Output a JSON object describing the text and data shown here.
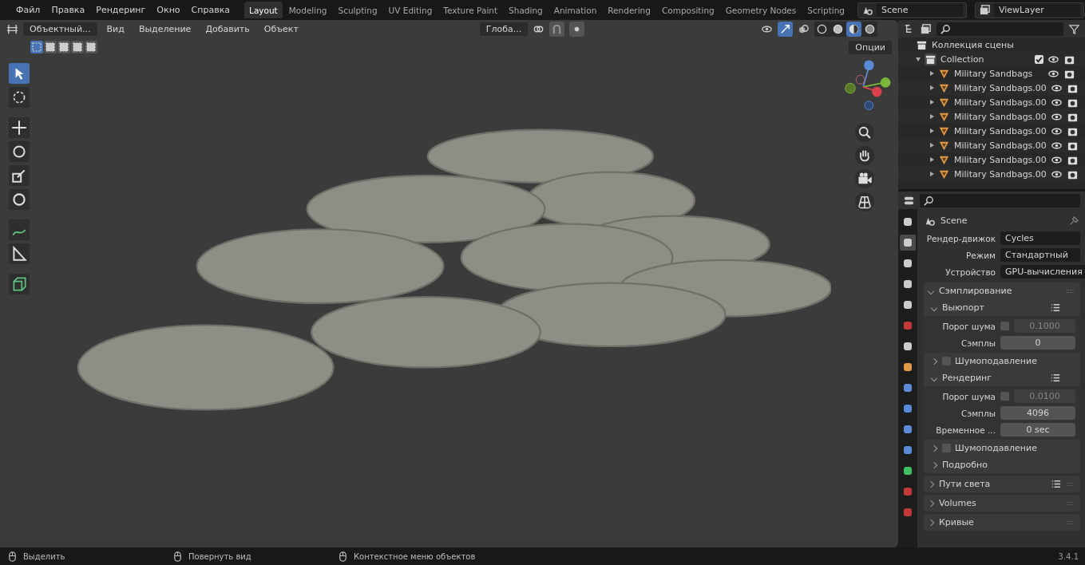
{
  "menu": [
    "Файл",
    "Правка",
    "Рендеринг",
    "Окно",
    "Справка"
  ],
  "workspaces": [
    {
      "label": "Layout",
      "selected": true
    },
    {
      "label": "Modeling",
      "selected": false
    },
    {
      "label": "Sculpting",
      "selected": false
    },
    {
      "label": "UV Editing",
      "selected": false
    },
    {
      "label": "Texture Paint",
      "selected": false
    },
    {
      "label": "Shading",
      "selected": false
    },
    {
      "label": "Animation",
      "selected": false
    },
    {
      "label": "Rendering",
      "selected": false
    },
    {
      "label": "Compositing",
      "selected": false
    },
    {
      "label": "Geometry Nodes",
      "selected": false
    },
    {
      "label": "Scripting",
      "selected": false
    }
  ],
  "scene": "Scene",
  "view_layer": "ViewLayer",
  "viewport": {
    "mode": "Объектный...",
    "menus": [
      "Вид",
      "Выделение",
      "Добавить",
      "Объект"
    ],
    "orientation": "Глоба...",
    "options": "Опции",
    "select_modes": [
      {
        "selected": true
      },
      {
        "selected": false
      },
      {
        "selected": false
      },
      {
        "selected": false
      },
      {
        "selected": false
      }
    ],
    "overlays_on": true,
    "shading": [
      {
        "kind": "wire",
        "selected": false
      },
      {
        "kind": "solid",
        "selected": false
      },
      {
        "kind": "material",
        "selected": true
      },
      {
        "kind": "rendered",
        "selected": false
      }
    ],
    "tools": [
      {
        "kind": "select",
        "selected": true
      },
      {
        "kind": "cursor",
        "selected": false
      },
      {
        "kind": "move",
        "selected": false
      },
      {
        "kind": "rotate",
        "selected": false
      },
      {
        "kind": "scale",
        "selected": false
      },
      {
        "kind": "transform",
        "selected": false
      },
      {
        "kind": "annotate",
        "selected": false
      },
      {
        "kind": "measure",
        "selected": false
      },
      {
        "kind": "addcube",
        "selected": false
      }
    ]
  },
  "outliner": {
    "scene_collection": "Коллекция сцены",
    "collection": {
      "name": "Collection",
      "expanded": true,
      "checked": true,
      "children": [
        {
          "name": "Military Sandbags"
        },
        {
          "name": "Military Sandbags.00"
        },
        {
          "name": "Military Sandbags.00"
        },
        {
          "name": "Military Sandbags.00"
        },
        {
          "name": "Military Sandbags.00"
        },
        {
          "name": "Military Sandbags.00"
        },
        {
          "name": "Military Sandbags.00"
        },
        {
          "name": "Military Sandbags.00"
        }
      ]
    }
  },
  "properties": {
    "tabs": [
      {
        "kind": "tool",
        "selected": false
      },
      {
        "kind": "render",
        "selected": true
      },
      {
        "kind": "output",
        "selected": false
      },
      {
        "kind": "viewlayer",
        "selected": false
      },
      {
        "kind": "scene",
        "selected": false
      },
      {
        "kind": "world",
        "selected": false
      },
      {
        "kind": "collection",
        "selected": false
      },
      {
        "kind": "object",
        "selected": false
      },
      {
        "kind": "modifier",
        "selected": false
      },
      {
        "kind": "particles",
        "selected": false
      },
      {
        "kind": "physics",
        "selected": false
      },
      {
        "kind": "constraints",
        "selected": false
      },
      {
        "kind": "data",
        "selected": false
      },
      {
        "kind": "material",
        "selected": false
      },
      {
        "kind": "texture",
        "selected": false
      }
    ],
    "title": "Scene",
    "fields": [
      {
        "label": "Рендер-движок",
        "value": "Cycles"
      },
      {
        "label": "Режим",
        "value": "Стандартный"
      },
      {
        "label": "Устройство",
        "value": "GPU-вычисления"
      }
    ],
    "panels": [
      {
        "title": "Сэмплирование",
        "expanded": true,
        "children": [
          {
            "title": "Выюпорт",
            "expanded": true,
            "presets": true,
            "rows": [
              {
                "label": "Порог шума",
                "value": "0.1000",
                "toggle": false
              },
              {
                "label": "Сэмплы",
                "value": "0"
              }
            ]
          },
          {
            "title": "Шумоподавление",
            "expanded": false,
            "checked": false
          },
          {
            "title": "Рендеринг",
            "expanded": true,
            "presets": true,
            "rows": [
              {
                "label": "Порог шума",
                "value": "0.0100",
                "toggle": false
              },
              {
                "label": "Сэмплы",
                "value": "4096"
              },
              {
                "label": "Временное ...",
                "value": "0 sec"
              }
            ]
          },
          {
            "title": "Шумоподавление",
            "expanded": false,
            "checked": false
          },
          {
            "title": "Подробно",
            "expanded": false
          }
        ]
      },
      {
        "title": "Пути света",
        "expanded": false,
        "presets": true
      },
      {
        "title": "Volumes",
        "expanded": false
      },
      {
        "title": "Кривые",
        "expanded": false
      }
    ]
  },
  "status_bar": {
    "hints": [
      "Выделить",
      "Повернуть вид",
      "Контекстное меню объектов"
    ],
    "version": "3.4.1"
  }
}
